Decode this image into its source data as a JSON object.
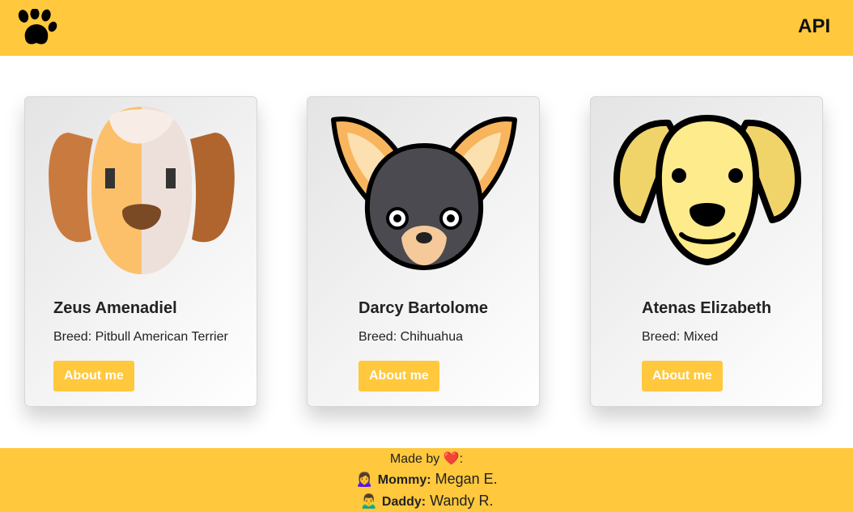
{
  "header": {
    "logo_icon": "paw-icon",
    "api_label": "API",
    "background": "#FFC83D"
  },
  "cards": [
    {
      "name": "Zeus Amenadiel",
      "breed": "Breed: Pitbull American Terrier",
      "button": "About me",
      "icon": "floppy-eared-dog-icon"
    },
    {
      "name": "Darcy Bartolome",
      "breed": "Breed: Chihuahua",
      "button": "About me",
      "icon": "chihuahua-icon"
    },
    {
      "name": "Atenas Elizabeth",
      "breed": "Breed: Mixed",
      "button": "About me",
      "icon": "golden-dog-icon"
    }
  ],
  "footer": {
    "made_by": "Made by",
    "heart": "❤️",
    "colon": ":",
    "mommy_emoji": "🙍‍♀️",
    "mommy_label": "Mommy:",
    "mommy_name": "Megan E.",
    "daddy_emoji": "🙍‍♂️",
    "daddy_label": "Daddy:",
    "daddy_name": "Wandy R."
  },
  "colors": {
    "accent": "#FFC83D",
    "button_text": "#FFFFFF"
  }
}
